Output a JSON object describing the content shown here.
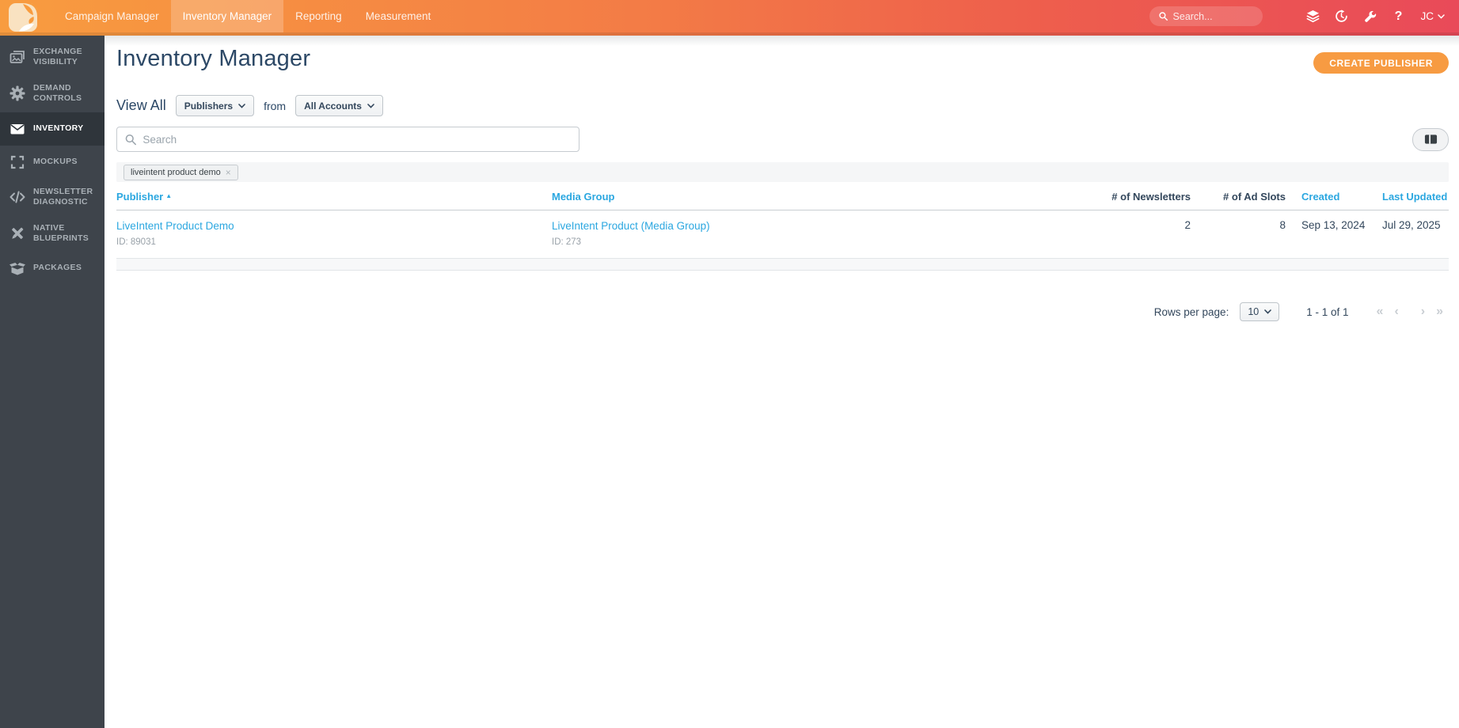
{
  "topbar": {
    "nav": [
      {
        "label": "Campaign Manager",
        "active": false
      },
      {
        "label": "Inventory Manager",
        "active": true
      },
      {
        "label": "Reporting",
        "active": false
      },
      {
        "label": "Measurement",
        "active": false
      }
    ],
    "search_placeholder": "Search...",
    "help_glyph": "?",
    "user_initials": "JC"
  },
  "sidebar": {
    "items": [
      {
        "label": "EXCHANGE VISIBILITY",
        "icon": "exchange-visibility-icon",
        "active": false
      },
      {
        "label": "DEMAND CONTROLS",
        "icon": "gear-icon",
        "active": false
      },
      {
        "label": "INVENTORY",
        "icon": "envelope-icon",
        "active": true
      },
      {
        "label": "MOCKUPS",
        "icon": "expand-icon",
        "active": false
      },
      {
        "label": "NEWSLETTER DIAGNOSTIC",
        "icon": "code-icon",
        "active": false
      },
      {
        "label": "NATIVE BLUEPRINTS",
        "icon": "design-tools-icon",
        "active": false
      },
      {
        "label": "PACKAGES",
        "icon": "package-icon",
        "active": false
      }
    ]
  },
  "page": {
    "title": "Inventory Manager",
    "create_button_label": "CREATE PUBLISHER",
    "filters": {
      "view_all_label": "View All",
      "type_value": "Publishers",
      "from_label": "from",
      "account_value": "All Accounts"
    },
    "search_placeholder": "Search",
    "filter_chip": {
      "label": "liveintent product demo",
      "close_glyph": "×"
    },
    "table": {
      "sort_arrow_glyph": "▲",
      "columns": [
        {
          "label": "Publisher",
          "sortable": true,
          "sorted": "asc"
        },
        {
          "label": "Media Group",
          "sortable": true
        },
        {
          "label": "# of Newsletters",
          "sortable": false
        },
        {
          "label": "# of Ad Slots",
          "sortable": false
        },
        {
          "label": "Created",
          "sortable": true
        },
        {
          "label": "Last Updated",
          "sortable": true
        }
      ],
      "rows": [
        {
          "publisher": "LiveIntent Product Demo",
          "publisher_id": "ID: 89031",
          "media_group": "LiveIntent Product (Media Group)",
          "media_group_id": "ID: 273",
          "newsletters": "2",
          "ad_slots": "8",
          "created": "Sep 13, 2024",
          "last_updated": "Jul 29, 2025"
        }
      ]
    },
    "pagination": {
      "rows_per_page_label": "Rows per page:",
      "rows_per_page_value": "10",
      "range_label": "1 - 1 of 1",
      "first_glyph": "«",
      "prev_glyph": "‹",
      "next_glyph": "›",
      "last_glyph": "»"
    }
  },
  "colors": {
    "accent_orange": "#F79B42",
    "brand_blue": "#2BA7E0",
    "navy_text": "#2C4866",
    "sidebar_bg": "#3E444B",
    "topbar_gradient_start": "#F89C3F",
    "topbar_gradient_end": "#E94A59"
  }
}
